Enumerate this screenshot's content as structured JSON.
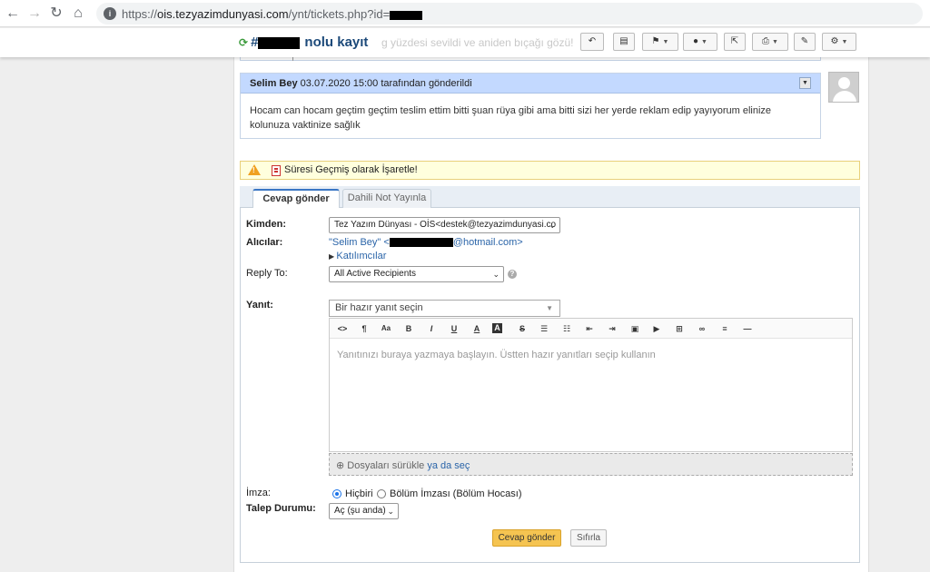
{
  "browser": {
    "url_prefix": "https://",
    "url_host": "ois.tezyazimdunyasi.com",
    "url_path": "/ynt/tickets.php?id="
  },
  "header": {
    "ticket_hash": "#",
    "ticket_suffix": "nolu kayıt",
    "ghost_text": "g yüzdesi sevildi ve aniden bıçağı gözü!"
  },
  "thread": {
    "author": "Selim Bey",
    "meta": "03.07.2020 15:00 tarafından gönderildi",
    "body": "Hocam can hocam geçtim geçtim teslim ettim bitti şuan rüya gibi ama bitti sizi her yerde reklam edip yayıyorum elinize kolunuza vaktinize sağlık"
  },
  "warning": {
    "text": "Süresi Geçmiş olarak İşaretle!"
  },
  "tabs": {
    "reply": "Cevap gönder",
    "note": "Dahili Not Yayınla"
  },
  "form": {
    "from_label": "Kimden:",
    "from_value": "Tez Yazım Dünyası - OİS<destek@tezyazimdunyasi.co",
    "to_label": "Alıcılar:",
    "to_name": "\"Selim Bey\" <",
    "to_domain": "@hotmail.com>",
    "collab_link": "Katılımcılar",
    "replyto_label": "Reply To:",
    "replyto_value": "All Active Recipients",
    "response_label": "Yanıt:",
    "canned_placeholder": "Bir hazır yanıt seçin",
    "editor_placeholder": "Yanıtınızı buraya yazmaya başlayın. Üstten hazır yanıtları seçip kullanın",
    "drop_text": "Dosyaları sürükle",
    "drop_link": "ya da seç",
    "signature_label": "İmza:",
    "sig_none": "Hiçbiri",
    "sig_dept": "Bölüm İmzası (Bölüm Hocası)",
    "status_label": "Talep Durumu:",
    "status_value": "Aç (şu anda)",
    "submit": "Cevap gönder",
    "reset": "Sıfırla"
  },
  "colors": {
    "entry_header": "#c3d9ff",
    "warning_bg": "#ffffdd",
    "primary_button": "#f5c451",
    "title": "#1d4a7a"
  }
}
